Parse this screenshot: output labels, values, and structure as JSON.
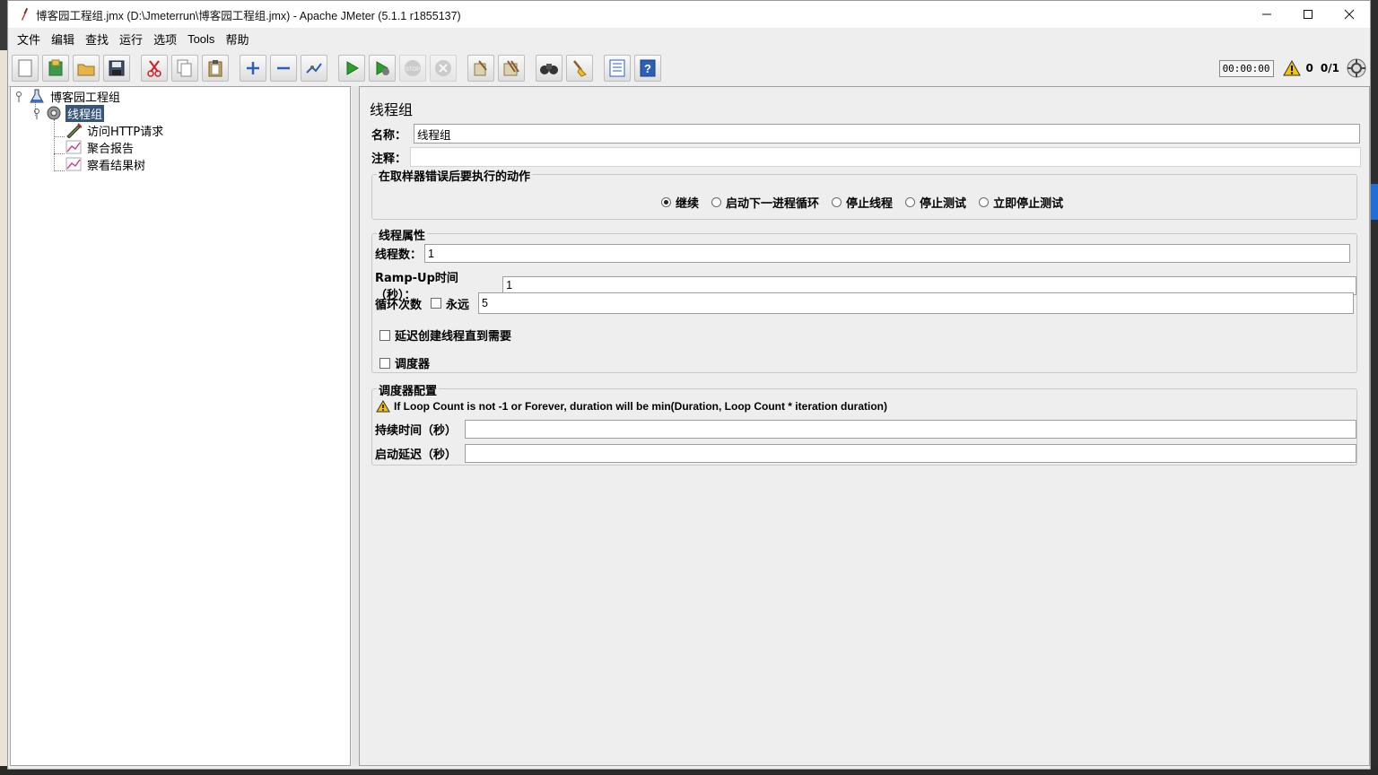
{
  "window": {
    "title": "博客园工程组.jmx (D:\\Jmeterrun\\博客园工程组.jmx) - Apache JMeter (5.1.1 r1855137)",
    "controls": [
      "—",
      "☐",
      "✕"
    ]
  },
  "menu": [
    "文件",
    "编辑",
    "查找",
    "运行",
    "选项",
    "Tools",
    "帮助"
  ],
  "toolbar": {
    "buttons": [
      "new-icon",
      "templates-icon",
      "open-icon",
      "save-icon",
      "cut-icon",
      "copy-icon",
      "paste-icon",
      "expand-icon",
      "collapse-icon",
      "toggle-icon",
      "start-icon",
      "start-no-pause-icon",
      "stop-icon",
      "shutdown-icon",
      "clear-icon",
      "clear-all-icon",
      "search-icon",
      "reset-search-icon",
      "function-helper-icon",
      "help-icon"
    ],
    "timer": "00:00:00",
    "warning_count": "0",
    "threads": "0/1"
  },
  "tree": {
    "root": "博客园工程组",
    "thread_group": "线程组",
    "children": [
      "访问HTTP请求",
      "聚合报告",
      "察看结果树"
    ]
  },
  "panel": {
    "title": "线程组",
    "name_label": "名称：",
    "name_value": "线程组",
    "comment_label": "注释：",
    "comment_value": "",
    "error_action": {
      "title": "在取样器错误后要执行的动作",
      "options": [
        "继续",
        "启动下一进程循环",
        "停止线程",
        "停止测试",
        "立即停止测试"
      ],
      "selected": "继续"
    },
    "thread_props": {
      "title": "线程属性",
      "threads_label": "线程数：",
      "threads_value": "1",
      "rampup_label": "Ramp-Up时间（秒）：",
      "rampup_value": "1",
      "loop_label": "循环次数",
      "forever_label": "永远",
      "loop_value": "5",
      "delay_label": "延迟创建线程直到需要",
      "scheduler_label": "调度器"
    },
    "scheduler": {
      "title": "调度器配置",
      "warning": "If Loop Count is not -1 or Forever, duration will be min(Duration, Loop Count * iteration duration)",
      "duration_label": "持续时间（秒）",
      "duration_value": "",
      "delay_label": "启动延迟（秒）",
      "delay_value": ""
    }
  },
  "colors": {
    "selection": "#37547a",
    "panel_bg": "#eeeeee",
    "start_green": "#2aa12a",
    "help_blue": "#2b5fb8"
  }
}
